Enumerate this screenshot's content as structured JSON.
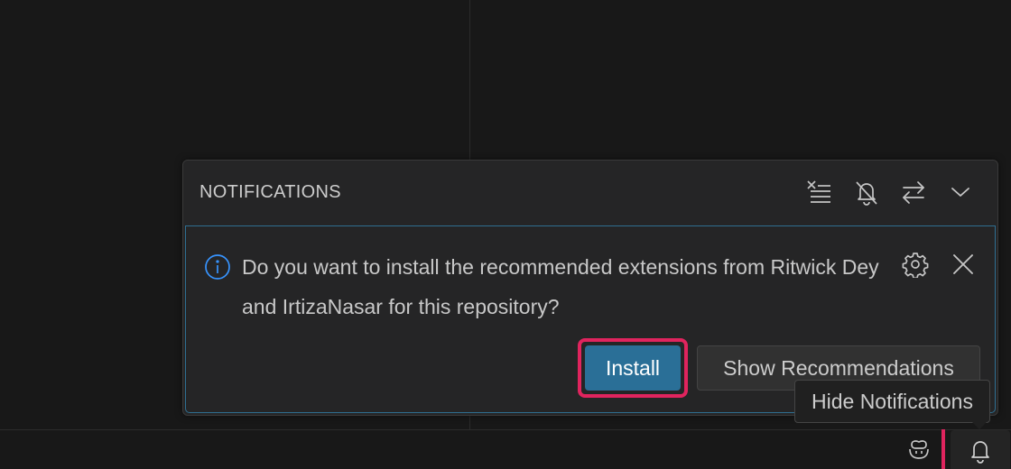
{
  "notifications": {
    "title": "NOTIFICATIONS",
    "header_actions": [
      {
        "icon": "clear-all-icon",
        "tooltip": "Clear All Notifications"
      },
      {
        "icon": "bell-slash-icon",
        "tooltip": "Toggle Do Not Disturb Mode"
      },
      {
        "icon": "arrow-swap-icon",
        "tooltip": "Toggle Notifications"
      },
      {
        "icon": "chevron-down-icon",
        "tooltip": "Hide Notifications"
      }
    ],
    "item": {
      "severity_icon": "info-icon",
      "message": "Do you want to install the recommended extensions from Ritwick Dey and IrtizaNasar for this repository?",
      "actions": {
        "primary": "Install",
        "secondary": "Show Recommendations"
      },
      "item_icons": [
        "gear-icon",
        "close-icon"
      ]
    }
  },
  "tooltip": {
    "text": "Hide Notifications"
  },
  "statusbar": {
    "icons": [
      "copilot-icon",
      "bell-icon"
    ]
  },
  "colors": {
    "accent": "#2a6f97",
    "highlight": "#e0245e",
    "background": "#181818",
    "panel": "#252526",
    "item_border": "#2f6f91"
  }
}
